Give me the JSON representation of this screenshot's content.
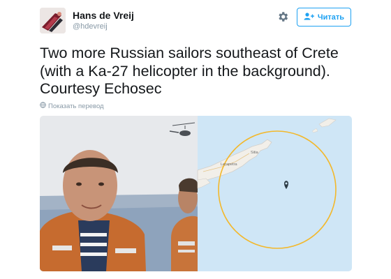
{
  "tweet": {
    "author": {
      "display_name": "Hans de Vreij",
      "username": "@hdevreij",
      "avatar_icon": "avatar-photo"
    },
    "settings_icon": "gear-icon",
    "follow_button": {
      "label": "Читать",
      "icon": "add-user-icon"
    },
    "text": "Two more Russian sailors southeast of Crete (with a Ka-27 helicopter in the background). Courtesy Echosec",
    "translate": {
      "label": "Показать перевод",
      "icon": "globe-icon"
    },
    "media": {
      "description_icon": "photo-with-map",
      "map": {
        "labels": [
          "Sitia",
          "Lerapetra"
        ],
        "pin_icon": "location-pin-icon",
        "circle_color": "#f3b82b",
        "water_color": "#cfe6f6"
      }
    }
  }
}
